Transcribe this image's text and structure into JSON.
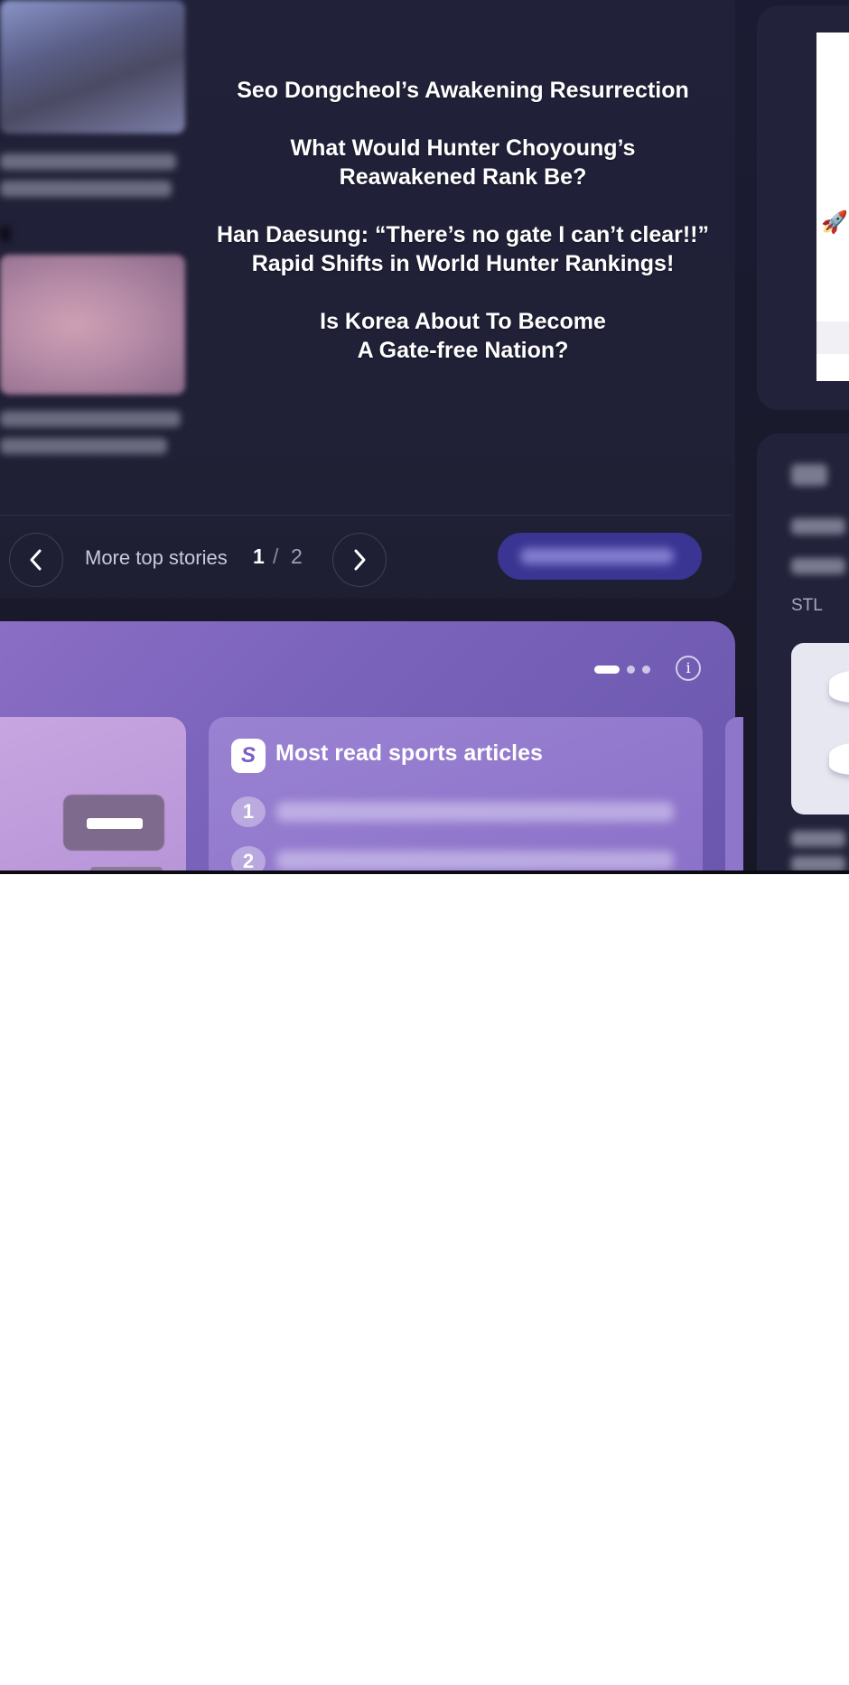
{
  "top_stories": {
    "headlines": [
      {
        "line1": "Seo Dongcheol’s Awakening Resurrection",
        "line2": ""
      },
      {
        "line1": "What Would Hunter Choyoung’s",
        "line2": "Reawakened Rank Be?"
      },
      {
        "line1": "Han Daesung: “There’s no gate I can’t clear!!”",
        "line2": "Rapid Shifts in World Hunter Rankings!"
      },
      {
        "line1": "Is Korea About To Become",
        "line2": "A Gate-free Nation?"
      }
    ],
    "pager": {
      "label": "More top stories",
      "current": "1",
      "separator": "/",
      "total": "2"
    },
    "prev_icon": "chevron-left-icon",
    "next_icon": "chevron-right-icon"
  },
  "side": {
    "stl_label": "STL",
    "rocket_icon": "🚀"
  },
  "carousel": {
    "info_icon": "i",
    "sports_card": {
      "logo_letter": "S",
      "title": "Most read sports articles",
      "ranks": [
        "1",
        "2"
      ]
    }
  },
  "colors": {
    "background": "#1b1b33",
    "panel": "#21213a",
    "accent_button": "#3a3493",
    "purple_panel": "#7a63bb"
  }
}
